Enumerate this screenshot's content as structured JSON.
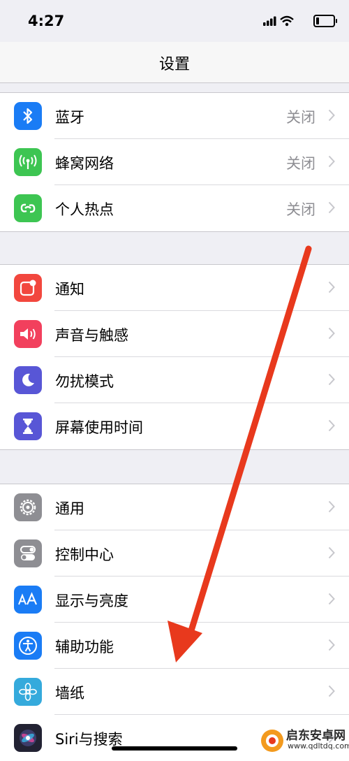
{
  "status_bar": {
    "time": "4:27"
  },
  "nav": {
    "title": "设置"
  },
  "groups": [
    {
      "items": [
        {
          "label": "蓝牙",
          "value": "关闭",
          "color": "#1a7cf5",
          "icon": "bluetooth-icon"
        },
        {
          "label": "蜂窝网络",
          "value": "关闭",
          "color": "#3dc552",
          "icon": "cellular-antenna-icon"
        },
        {
          "label": "个人热点",
          "value": "关闭",
          "color": "#3dc552",
          "icon": "hotspot-link-icon"
        }
      ]
    },
    {
      "items": [
        {
          "label": "通知",
          "value": "",
          "color": "#f2473e",
          "icon": "notification-icon"
        },
        {
          "label": "声音与触感",
          "value": "",
          "color": "#f2405d",
          "icon": "speaker-icon"
        },
        {
          "label": "勿扰模式",
          "value": "",
          "color": "#5856d6",
          "icon": "moon-icon"
        },
        {
          "label": "屏幕使用时间",
          "value": "",
          "color": "#5856d6",
          "icon": "hourglass-icon"
        }
      ]
    },
    {
      "items": [
        {
          "label": "通用",
          "value": "",
          "color": "#8e8e93",
          "icon": "gear-icon"
        },
        {
          "label": "控制中心",
          "value": "",
          "color": "#8e8e93",
          "icon": "toggles-icon"
        },
        {
          "label": "显示与亮度",
          "value": "",
          "color": "#1a7cf5",
          "icon": "text-size-icon"
        },
        {
          "label": "辅助功能",
          "value": "",
          "color": "#1a7cf5",
          "icon": "accessibility-icon"
        },
        {
          "label": "墙纸",
          "value": "",
          "color": "#35aadc",
          "icon": "flower-icon"
        },
        {
          "label": "Siri与搜索",
          "value": "",
          "color": "#222233",
          "icon": "siri-icon"
        }
      ]
    }
  ],
  "watermark": {
    "name": "启东安卓网",
    "url": "www.qdltdq.com"
  },
  "annotation_color": "#e8391d"
}
